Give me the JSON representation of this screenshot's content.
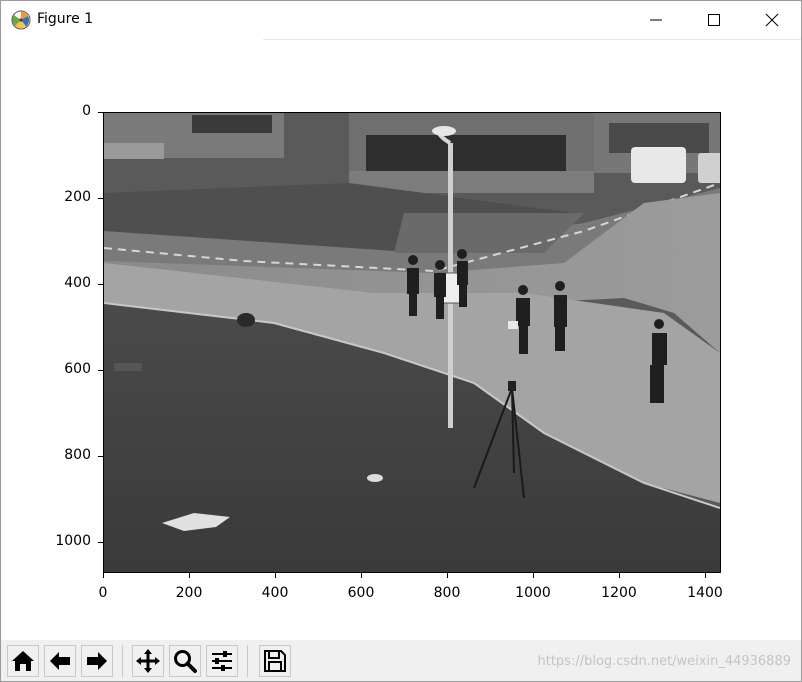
{
  "window": {
    "title": "Figure 1",
    "icon": "matplotlib-icon",
    "controls": [
      "minimize-icon",
      "maximize-icon",
      "close-icon"
    ]
  },
  "plot": {
    "image_description_hidden": true,
    "y_ticks": [
      "0",
      "200",
      "400",
      "600",
      "800",
      "1000"
    ],
    "x_ticks": [
      "0",
      "200",
      "400",
      "600",
      "800",
      "1000",
      "1200",
      "1400"
    ],
    "x_range": [
      0,
      1440
    ],
    "y_range": [
      0,
      1075
    ]
  },
  "toolbar": {
    "buttons": [
      "home-icon",
      "back-icon",
      "forward-icon",
      "pan-icon",
      "zoom-icon",
      "configure-subplots-icon",
      "save-icon"
    ]
  },
  "footer": {
    "watermark": "https://blog.csdn.net/weixin_44936889"
  }
}
